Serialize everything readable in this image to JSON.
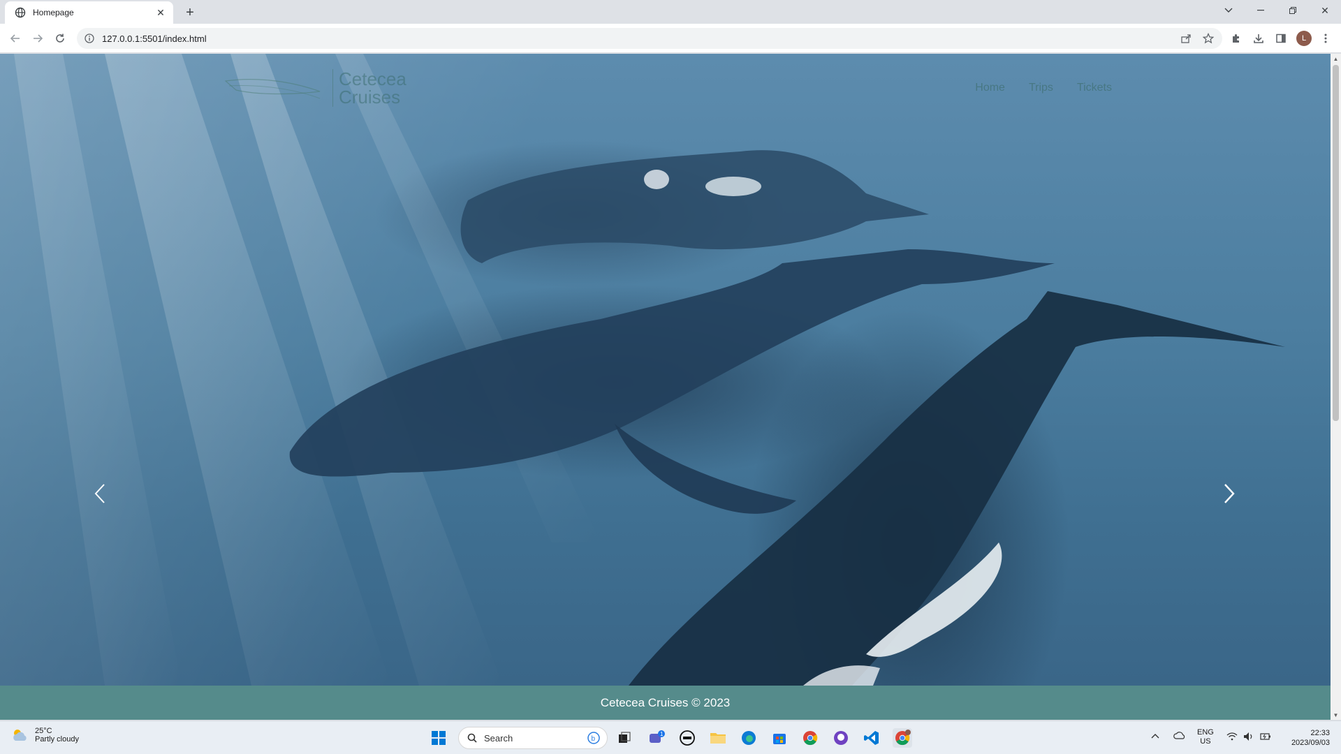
{
  "browser": {
    "tab_title": "Homepage",
    "url": "127.0.0.1:5501/index.html",
    "profile_initial": "L"
  },
  "site": {
    "logo_line1": "Cetecea",
    "logo_line2": "Cruises",
    "nav": [
      {
        "label": "Home"
      },
      {
        "label": "Trips"
      },
      {
        "label": "Tickets"
      }
    ],
    "footer_text": "Cetecea Cruises © 2023"
  },
  "taskbar": {
    "weather_temp": "25°C",
    "weather_condition": "Partly cloudy",
    "search_label": "Search",
    "language": "ENG",
    "region": "US",
    "time": "22:33",
    "date": "2023/09/03",
    "teams_badge": "1"
  },
  "colors": {
    "footer_bg": "#558b8b",
    "hero_water": "#4b7d9f"
  }
}
